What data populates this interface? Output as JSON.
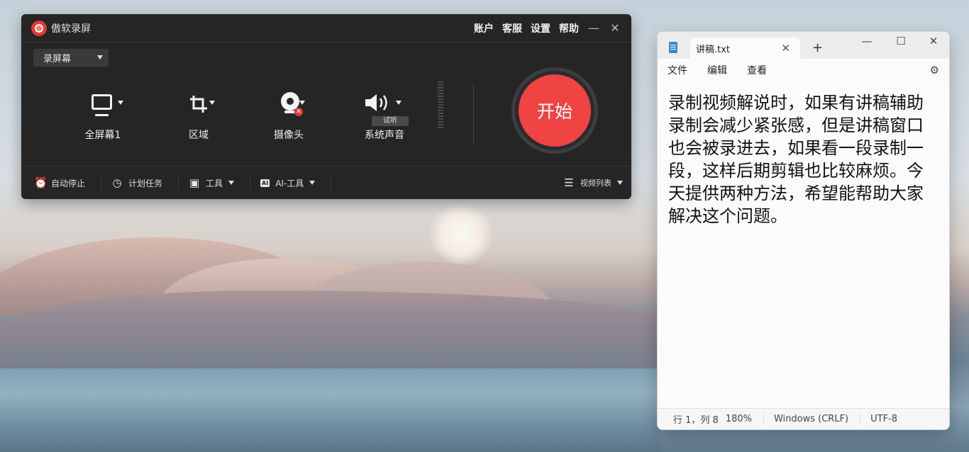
{
  "recorder": {
    "app_name": "傲软录屏",
    "menu": [
      "账户",
      "客服",
      "设置",
      "帮助"
    ],
    "mode_select": "录屏幕",
    "sources": {
      "fullscreen": "全屏幕1",
      "region": "区域",
      "camera": "摄像头",
      "audio": "系统声音",
      "audio_try": "试听"
    },
    "start_label": "开始",
    "bottom": {
      "auto_stop": "自动停止",
      "schedule": "计划任务",
      "tools": "工具",
      "ai_tools": "AI-工具",
      "ai_badge": "AI",
      "video_list": "视频列表"
    }
  },
  "notepad": {
    "tab_title": "讲稿.txt",
    "menu": [
      "文件",
      "编辑",
      "查看"
    ],
    "content": "录制视频解说时，如果有讲稿辅助录制会减少紧张感，但是讲稿窗口也会被录进去，如果看一段录制一段，这样后期剪辑也比较麻烦。今天提供两种方法，希望能帮助大家解决这个问题。",
    "status": {
      "position": "行 1，列 8",
      "zoom": "180%",
      "line_ending": "Windows (CRLF)",
      "encoding": "UTF-8"
    }
  }
}
